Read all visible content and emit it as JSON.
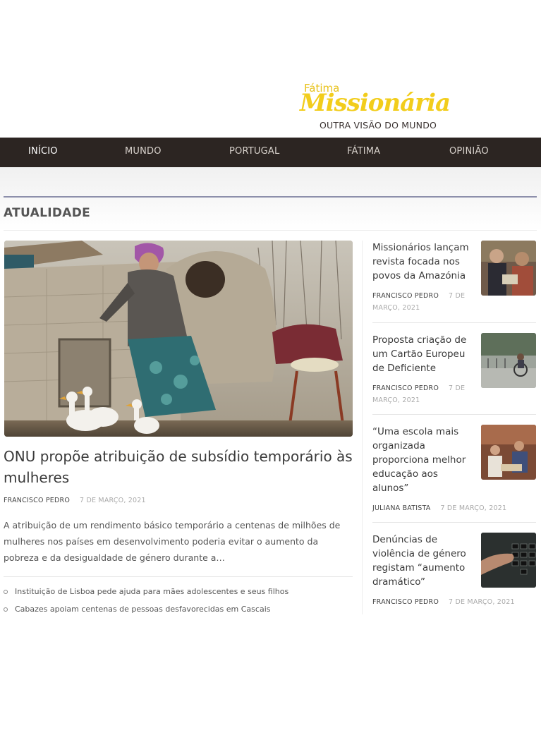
{
  "brand": {
    "small": "Fátima",
    "big": "Missionária",
    "tagline": "OUTRA VISÃO DO MUNDO",
    "color": "#f2cd1c"
  },
  "nav": {
    "items": [
      {
        "label": "INÍCIO"
      },
      {
        "label": "MUNDO"
      },
      {
        "label": "PORTUGAL"
      },
      {
        "label": "FÁTIMA"
      },
      {
        "label": "OPINIÃO"
      }
    ]
  },
  "section": {
    "title": "ATUALIDADE"
  },
  "feature": {
    "title": "ONU propõe atribuição de subsídio temporário às mulheres",
    "author": "FRANCISCO PEDRO",
    "date": "7 DE MARÇO, 2021",
    "excerpt": "A atribuição de um rendimento básico temporário a centenas de milhões de mulheres nos países em desenvolvimento poderia evitar o aumento da pobreza e da desigualdade de género durante a…",
    "related": [
      "Instituição de Lisboa pede ajuda para mães adolescentes e seus filhos",
      "Cabazes apoiam centenas de pessoas desfavorecidas em Cascais"
    ]
  },
  "sidebar": [
    {
      "title": "Missionários lançam revista focada nos povos da Amazónia",
      "author": "FRANCISCO PEDRO",
      "date": "7 DE MARÇO, 2021"
    },
    {
      "title": "Proposta criação de um Cartão Europeu de Deficiente",
      "author": "FRANCISCO PEDRO",
      "date": "7 DE MARÇO, 2021"
    },
    {
      "title": "“Uma escola mais organizada proporciona melhor educação aos alunos”",
      "author": "JULIANA BATISTA",
      "date": "7 DE MARÇO, 2021"
    },
    {
      "title": "Denúncias de violência de género registam “aumento dramático”",
      "author": "FRANCISCO PEDRO",
      "date": "7 DE MARÇO, 2021"
    }
  ]
}
